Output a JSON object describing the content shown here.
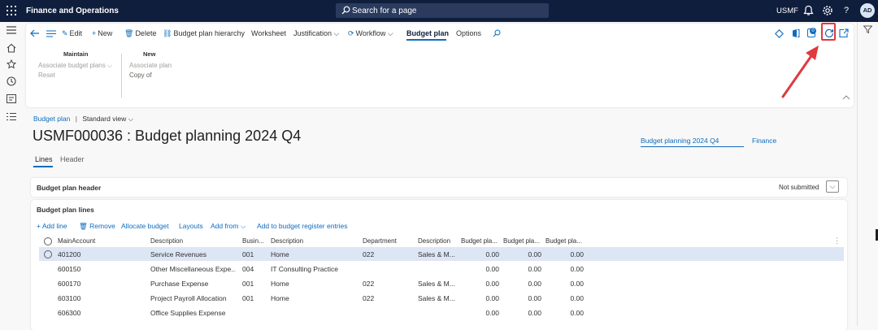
{
  "topbar": {
    "app_title": "Finance and Operations",
    "search_placeholder": "Search for a page",
    "company": "USMF",
    "avatar_initials": "AD",
    "help": "?"
  },
  "action_pane": {
    "items": {
      "edit": "Edit",
      "new": "New",
      "delete": "Delete",
      "hierarchy": "Budget plan hierarchy",
      "worksheet": "Worksheet",
      "justification": "Justification",
      "workflow": "Workflow",
      "budget_plan": "Budget plan",
      "options": "Options"
    },
    "notification_count": "0",
    "groups": {
      "maintain": {
        "title": "Maintain",
        "items": [
          "Associate budget plans",
          "Reset"
        ]
      },
      "new": {
        "title": "New",
        "items": [
          "Associate plan",
          "Copy of"
        ]
      }
    }
  },
  "breadcrumb": {
    "link": "Budget plan",
    "separator": "|",
    "view": "Standard view"
  },
  "page_title": "USMF000036 : Budget planning 2024 Q4",
  "fields": {
    "name": "Budget planning 2024 Q4",
    "finance": "Finance"
  },
  "tabs": {
    "lines": "Lines",
    "header": "Header"
  },
  "header_card": {
    "title": "Budget plan header",
    "status": "Not submitted"
  },
  "lines_card": {
    "title": "Budget plan lines",
    "toolbar": {
      "add_line": "Add line",
      "remove": "Remove",
      "allocate": "Allocate budget",
      "layouts": "Layouts",
      "add_from": "Add from",
      "add_register": "Add to budget register entries"
    },
    "columns": [
      "MainAccount",
      "Description",
      "Busin...",
      "Description",
      "Department",
      "Description",
      "Budget pla...",
      "Budget pla...",
      "Budget pla..."
    ],
    "rows": [
      [
        "401200",
        "Service Revenues",
        "001",
        "Home",
        "022",
        "Sales & M...",
        "0.00",
        "0.00",
        "0.00"
      ],
      [
        "600150",
        "Other Miscellaneous Expe...",
        "004",
        "IT Consulting Practice",
        "",
        "",
        "0.00",
        "0.00",
        "0.00"
      ],
      [
        "600170",
        "Purchase Expense",
        "001",
        "Home",
        "022",
        "Sales & M...",
        "0.00",
        "0.00",
        "0.00"
      ],
      [
        "603100",
        "Project Payroll Allocation",
        "001",
        "Home",
        "022",
        "Sales & M...",
        "0.00",
        "0.00",
        "0.00"
      ],
      [
        "606300",
        "Office Supplies Expense",
        "",
        "",
        "",
        "",
        "0.00",
        "0.00",
        "0.00"
      ]
    ]
  },
  "colors": {
    "topbar": "#0f1e3c",
    "accent": "#0f6cbd",
    "highlight": "#e0393e",
    "selected_row": "#dde6f5"
  }
}
